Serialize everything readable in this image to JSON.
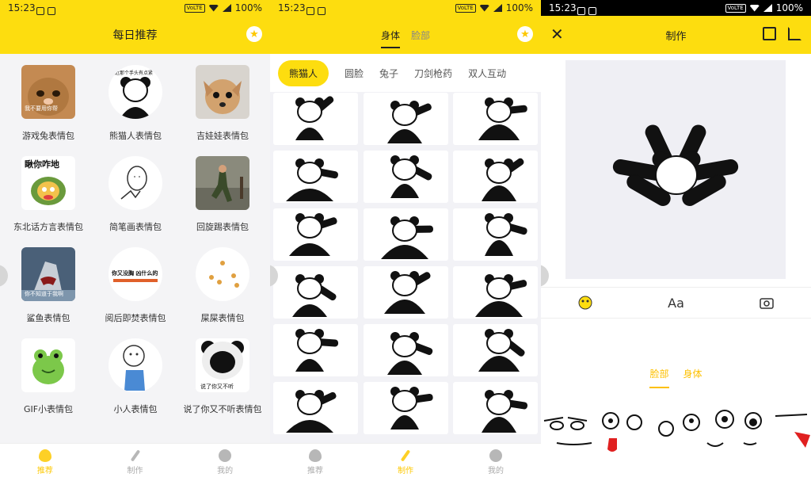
{
  "status": {
    "time": "15:23",
    "volte": "VoLTE",
    "battery": "100%"
  },
  "panel1": {
    "title": "每日推荐",
    "items": [
      {
        "label": "游戏兔表情包"
      },
      {
        "label": "熊猫人表情包"
      },
      {
        "label": "吉娃娃表情包"
      },
      {
        "label": "东北话方言表情包"
      },
      {
        "label": "简笔画表情包"
      },
      {
        "label": "回旋踢表情包"
      },
      {
        "label": "鲨鱼表情包"
      },
      {
        "label": "阅后即焚表情包"
      },
      {
        "label": "屎屎表情包"
      },
      {
        "label": "GIF小表情包"
      },
      {
        "label": "小人表情包"
      },
      {
        "label": "说了你又不听表情包"
      }
    ],
    "thumb_texts": {
      "rabbit": "我不要用你帮",
      "panda_caption": "最近那个手头有点紧",
      "dongbei": "瞅你咋地",
      "fenshu": "你又没胸 凶什么的",
      "shark": "你不知道于我啊",
      "shuoleni": "说了你又不听"
    }
  },
  "nav": {
    "recommend": "推荐",
    "make": "制作",
    "mine": "我的"
  },
  "panel2": {
    "tabs": [
      "身体",
      "脸部"
    ],
    "chips": [
      "熊猫人",
      "圆脸",
      "兔子",
      "刀剑枪药",
      "双人互动"
    ]
  },
  "panel3": {
    "title": "制作",
    "tool_text": "Aa",
    "subtabs": [
      "脸部",
      "身体"
    ]
  },
  "colors": {
    "accent": "#fddd0f",
    "accent_text": "#fdc000"
  }
}
